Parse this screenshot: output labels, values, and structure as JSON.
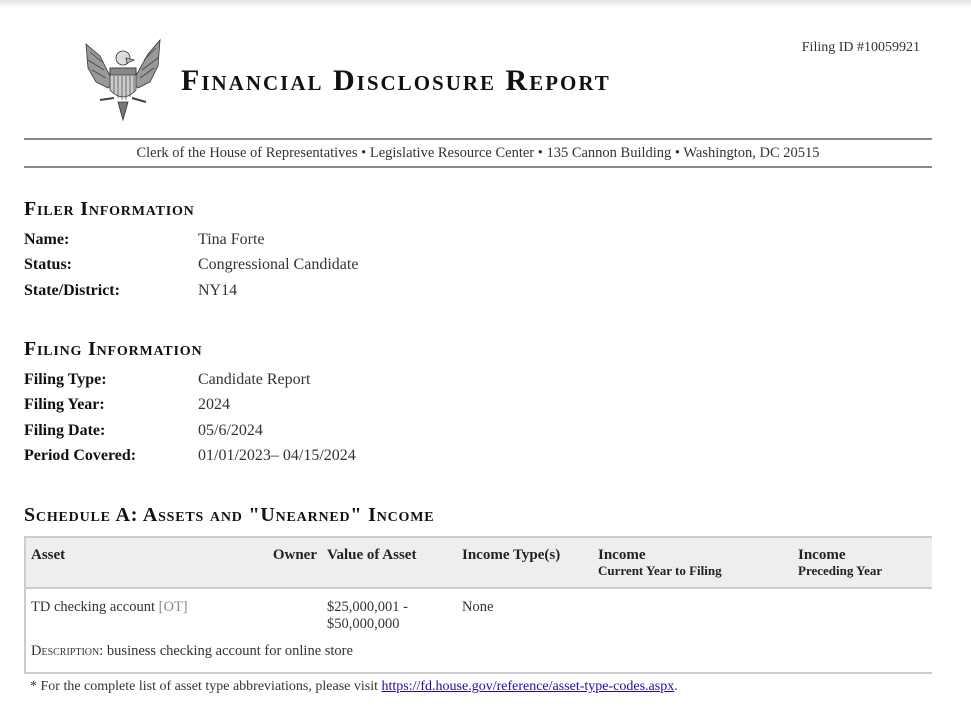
{
  "header": {
    "title": "Financial Disclosure Report",
    "filing_id": "Filing ID #10059921",
    "address": "Clerk of the House of Representatives • Legislative Resource Center • 135 Cannon Building • Washington, DC 20515",
    "seal_icon": "eagle-seal-icon"
  },
  "filer": {
    "heading": "Filer Information",
    "fields": [
      {
        "label": "Name:",
        "value": "Tina Forte"
      },
      {
        "label": "Status:",
        "value": "Congressional Candidate"
      },
      {
        "label": "State/District:",
        "value": "NY14"
      }
    ]
  },
  "filing": {
    "heading": "Filing Information",
    "fields": [
      {
        "label": "Filing Type:",
        "value": "Candidate Report"
      },
      {
        "label": "Filing Year:",
        "value": "2024"
      },
      {
        "label": "Filing Date:",
        "value": "05/6/2024"
      },
      {
        "label": "Period Covered:",
        "value": "01/01/2023– 04/15/2024"
      }
    ]
  },
  "schedule_a": {
    "heading": "Schedule A: Assets and \"Unearned\" Income",
    "columns": {
      "asset": "Asset",
      "owner": "Owner",
      "value": "Value of Asset",
      "income_type": "Income Type(s)",
      "income_current": "Income",
      "income_current_sub": "Current Year to Filing",
      "income_preceding": "Income",
      "income_preceding_sub": "Preceding Year"
    },
    "rows": [
      {
        "asset": "TD checking account",
        "asset_code": "[OT]",
        "owner": "",
        "value_line1": "$25,000,001 -",
        "value_line2": "$50,000,000",
        "income_type": "None",
        "income_current": "",
        "income_preceding": "",
        "description_label": "Description:",
        "description": "business checking account for online store"
      }
    ],
    "footnote_text": "* For the complete list of asset type abbreviations, please visit ",
    "footnote_link": "https://fd.house.gov/reference/asset-type-codes.aspx",
    "footnote_end": "."
  }
}
